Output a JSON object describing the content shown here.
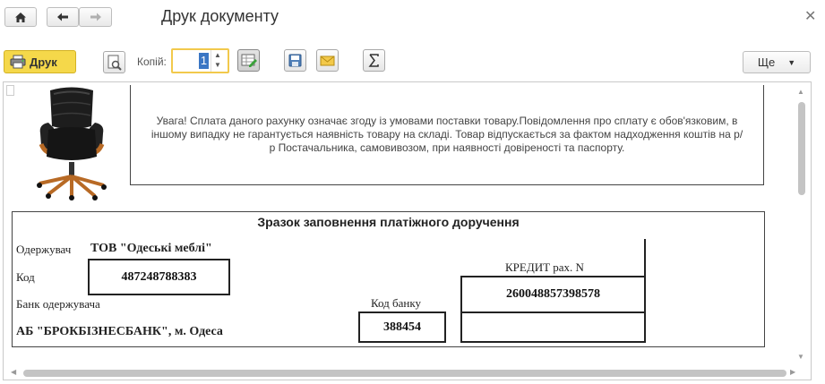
{
  "window": {
    "title": "Друк документу"
  },
  "toolbar": {
    "print_label": "Друк",
    "copies_label": "Копій:",
    "copies_value": "1",
    "more_label": "Ще"
  },
  "document": {
    "notice": "Увага! Сплата даного рахунку означає згоду із умовами поставки товару.Повідомлення про сплату є обов'язковим, в іншому випадку не гарантується наявність товару на складі. Товар відпускається за фактом надходження коштів на р/р Постачальника, самовивозом, при наявності довіреності та паспорту.",
    "sample_title": "Зразок заповнення платіжного доручення",
    "recipient_label": "Одержувач",
    "recipient_value": "ТОВ \"Одеські меблі\"",
    "code_label": "Код",
    "code_value": "487248788383",
    "bank_label": "Банк одержувача",
    "bank_value": "АБ \"БРОКБІЗНЕСБАНК\", м. Одеса",
    "bank_code_label": "Код банку",
    "bank_code_value": "388454",
    "credit_label": "КРЕДИТ рах. N",
    "credit_value": "260048857398578"
  }
}
